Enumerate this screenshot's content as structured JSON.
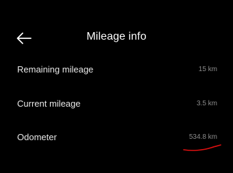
{
  "header": {
    "back_icon": "arrow-left-icon",
    "title": "Mileage info"
  },
  "rows": [
    {
      "label": "Remaining mileage",
      "value": "15 km"
    },
    {
      "label": "Current mileage",
      "value": "3.5 km"
    },
    {
      "label": "Odometer",
      "value": "534.8 km"
    }
  ],
  "colors": {
    "background": "#000000",
    "text_primary": "#ffffff",
    "text_secondary": "#8c8c8c",
    "annotation": "#e01010"
  }
}
